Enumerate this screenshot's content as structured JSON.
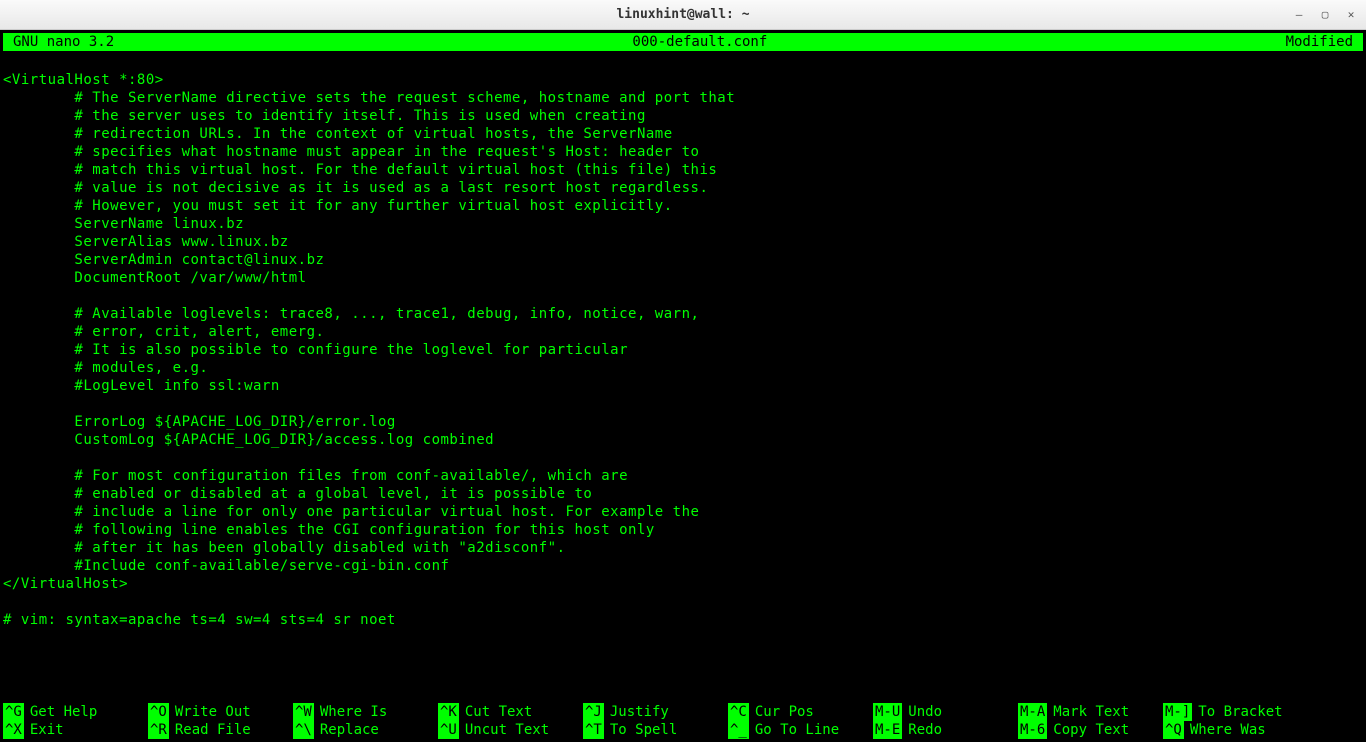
{
  "window": {
    "title": "linuxhint@wall: ~"
  },
  "nano": {
    "header": {
      "version": "GNU nano 3.2",
      "filename": "000-default.conf",
      "status": "Modified"
    },
    "content": [
      "",
      "<VirtualHost *:80>",
      "        # The ServerName directive sets the request scheme, hostname and port that",
      "        # the server uses to identify itself. This is used when creating",
      "        # redirection URLs. In the context of virtual hosts, the ServerName",
      "        # specifies what hostname must appear in the request's Host: header to",
      "        # match this virtual host. For the default virtual host (this file) this",
      "        # value is not decisive as it is used as a last resort host regardless.",
      "        # However, you must set it for any further virtual host explicitly.",
      "        ServerName linux.bz",
      "        ServerAlias www.linux.bz",
      "        ServerAdmin contact@linux.bz",
      "        DocumentRoot /var/www/html",
      "",
      "        # Available loglevels: trace8, ..., trace1, debug, info, notice, warn,",
      "        # error, crit, alert, emerg.",
      "        # It is also possible to configure the loglevel for particular",
      "        # modules, e.g.",
      "        #LogLevel info ssl:warn",
      "",
      "        ErrorLog ${APACHE_LOG_DIR}/error.log",
      "        CustomLog ${APACHE_LOG_DIR}/access.log combined",
      "",
      "        # For most configuration files from conf-available/, which are",
      "        # enabled or disabled at a global level, it is possible to",
      "        # include a line for only one particular virtual host. For example the",
      "        # following line enables the CGI configuration for this host only",
      "        # after it has been globally disabled with \"a2disconf\".",
      "        #Include conf-available/serve-cgi-bin.conf",
      "</VirtualHost>",
      "",
      "# vim: syntax=apache ts=4 sw=4 sts=4 sr noet"
    ],
    "shortcuts": {
      "row1": [
        {
          "key": "^G",
          "label": "Get Help"
        },
        {
          "key": "^O",
          "label": "Write Out"
        },
        {
          "key": "^W",
          "label": "Where Is"
        },
        {
          "key": "^K",
          "label": "Cut Text"
        },
        {
          "key": "^J",
          "label": "Justify"
        },
        {
          "key": "^C",
          "label": "Cur Pos"
        },
        {
          "key": "M-U",
          "label": "Undo"
        },
        {
          "key": "M-A",
          "label": "Mark Text"
        },
        {
          "key": "M-]",
          "label": "To Bracket"
        }
      ],
      "row2": [
        {
          "key": "^X",
          "label": "Exit"
        },
        {
          "key": "^R",
          "label": "Read File"
        },
        {
          "key": "^\\",
          "label": "Replace"
        },
        {
          "key": "^U",
          "label": "Uncut Text"
        },
        {
          "key": "^T",
          "label": "To Spell"
        },
        {
          "key": "^_",
          "label": "Go To Line"
        },
        {
          "key": "M-E",
          "label": "Redo"
        },
        {
          "key": "M-6",
          "label": "Copy Text"
        },
        {
          "key": "^Q",
          "label": "Where Was"
        }
      ]
    }
  }
}
